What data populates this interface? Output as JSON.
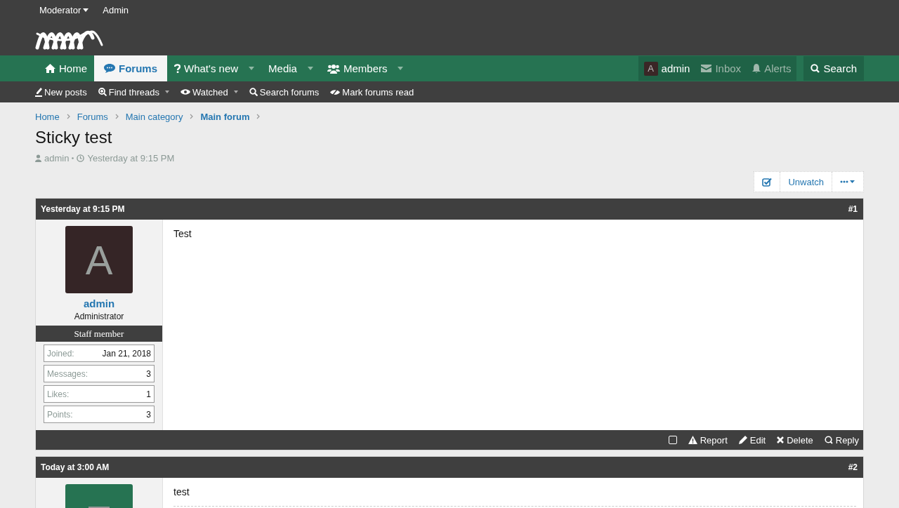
{
  "top_links": [
    {
      "label": "Moderator",
      "caret": true
    },
    {
      "label": "Admin",
      "caret": false
    }
  ],
  "nav": [
    {
      "label": "Home",
      "selected": false,
      "caret": false
    },
    {
      "label": "Forums",
      "selected": true,
      "caret": false
    },
    {
      "label": "What's new",
      "selected": false,
      "caret": true
    },
    {
      "label": "Media",
      "selected": false,
      "caret": true
    },
    {
      "label": "Members",
      "selected": false,
      "caret": true
    }
  ],
  "account": {
    "avatar_letter": "A",
    "username": "admin",
    "inbox": "Inbox",
    "alerts": "Alerts",
    "search": "Search"
  },
  "subnav": [
    {
      "label": "New posts",
      "caret": false
    },
    {
      "label": "Find threads",
      "caret": true
    },
    {
      "label": "Watched",
      "caret": true
    },
    {
      "label": "Search forums",
      "caret": false
    },
    {
      "label": "Mark forums read",
      "caret": false
    }
  ],
  "breadcrumbs": [
    {
      "label": "Home",
      "current": false
    },
    {
      "label": "Forums",
      "current": false
    },
    {
      "label": "Main category",
      "current": false
    },
    {
      "label": "Main forum",
      "current": true
    }
  ],
  "thread": {
    "title": "Sticky test",
    "author": "admin",
    "date": "Yesterday at 9:15 PM"
  },
  "thread_buttons": {
    "unwatch": "Unwatch"
  },
  "posts": [
    {
      "date": "Yesterday at 9:15 PM",
      "number": "#1",
      "avatar_letter": "A",
      "username": "admin",
      "role": "Administrator",
      "badge": "Staff member",
      "stats": [
        {
          "label": "Joined:",
          "value": "Jan 21, 2018"
        },
        {
          "label": "Messages:",
          "value": "3"
        },
        {
          "label": "Likes:",
          "value": "1"
        },
        {
          "label": "Points:",
          "value": "3"
        }
      ],
      "body": "Test",
      "selected": false,
      "actions": [
        "Report",
        "Edit",
        "Delete",
        "Reply"
      ]
    },
    {
      "date": "Today at 3:00 AM",
      "number": "#2",
      "body": "test"
    }
  ]
}
